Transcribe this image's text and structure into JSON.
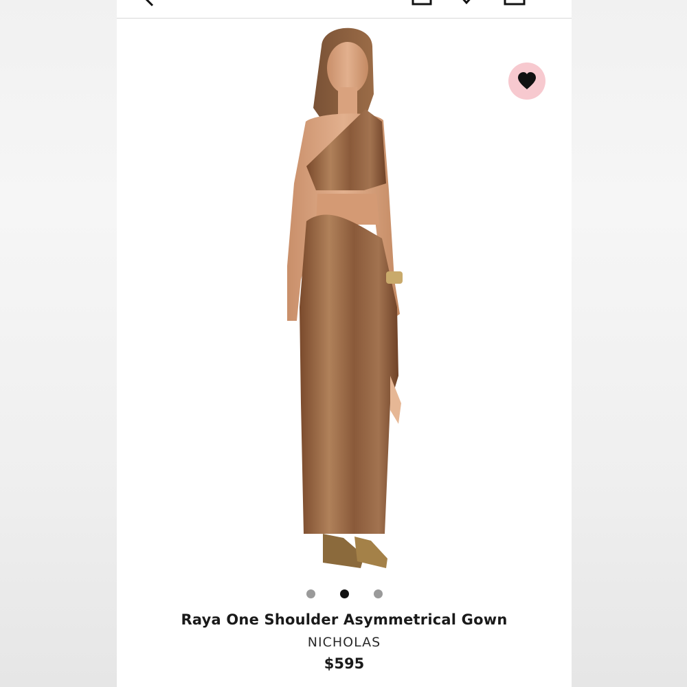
{
  "product": {
    "name": "Raya One Shoulder Asymmetrical Gown",
    "brand": "NICHOLAS",
    "price": "$595"
  },
  "carousel": {
    "count": 3,
    "active_index": 1
  },
  "colors": {
    "favorite_bg": "#f7c9cf",
    "dress": "#8a5a3a"
  },
  "icons": [
    "back-arrow-icon",
    "bag-icon",
    "heart-icon",
    "cart-icon",
    "favorite-heart-icon"
  ]
}
